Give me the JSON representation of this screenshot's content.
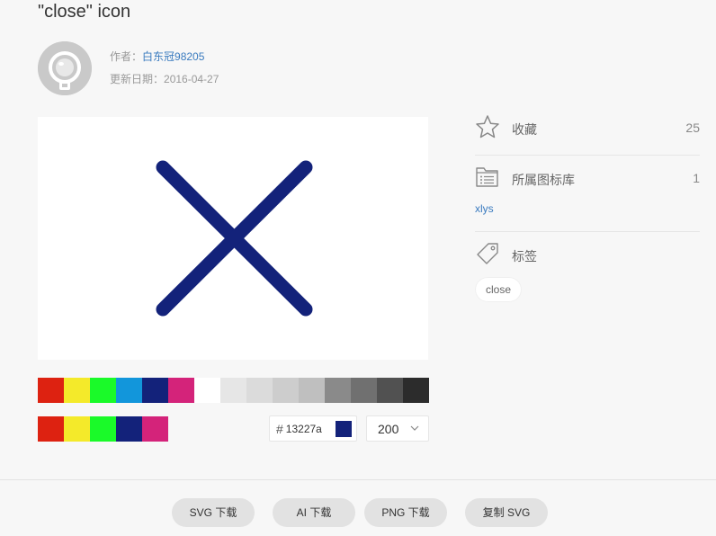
{
  "page": {
    "title": "\"close\" icon"
  },
  "author": {
    "label": "作者：",
    "name": "白东冠98205",
    "date_label": "更新日期：",
    "date": "2016-04-27"
  },
  "icon": {
    "name": "close-icon",
    "color": "#13227a"
  },
  "palette": {
    "row1": [
      "#dd2211",
      "#f4ea2a",
      "#1afa29",
      "#1296db",
      "#13227a",
      "#d4237a",
      "#ffffff",
      "#e6e6e6",
      "#dbdbdb",
      "#cdcdcd",
      "#bfbfbf",
      "#8a8a8a",
      "#707070",
      "#515151",
      "#2c2c2c"
    ],
    "row2": [
      "#dd2211",
      "#f4ea2a",
      "#1afa29",
      "#13227a",
      "#d4237a"
    ]
  },
  "color_input": {
    "hash": "#",
    "value": "13227a",
    "swatch": "#13227a"
  },
  "size_select": {
    "value": "200"
  },
  "sidebar": {
    "favorite": {
      "icon": "star-icon",
      "label": "收藏",
      "count": "25"
    },
    "library": {
      "icon": "list-folder-icon",
      "label": "所属图标库",
      "count": "1",
      "link": "xlys"
    },
    "tags": {
      "icon": "tag-icon",
      "label": "标签",
      "items": [
        "close"
      ]
    }
  },
  "footer": {
    "buttons": [
      "SVG 下载",
      "AI 下载",
      "PNG 下载",
      "复制 SVG"
    ]
  }
}
